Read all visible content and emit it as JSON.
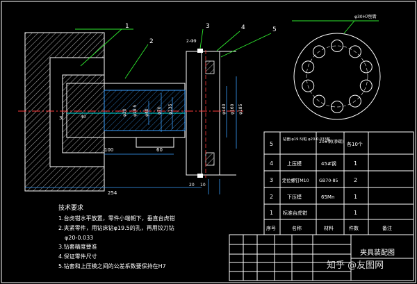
{
  "colors": {
    "background": "#000000",
    "outline": "#ffffff",
    "leader": "#2ee82e",
    "dimension": "#3aa0ff",
    "centerline": "#ff3b3b",
    "cyan": "#00e5e5",
    "yellow": "#ffe600",
    "magenta": "#ff33ff"
  },
  "balloons": [
    "1",
    "2",
    "3",
    "4",
    "5"
  ],
  "dims": {
    "overall_length": "254",
    "d100": "100",
    "d60": "60",
    "d3": "3",
    "d40": "40",
    "d10": "10",
    "d20": "20",
    "d60v": "60",
    "d185": "φ185",
    "d160": "φ160",
    "d140": "φ140",
    "d135": "φ135",
    "d70": "φ70",
    "d40s": "φ40",
    "d195": "φ19.5",
    "d20h": "φ20",
    "d30": "φ30H7"
  },
  "annotations": {
    "top_callout": "2-Φ9",
    "hole_callout": "φ30H7刨青"
  },
  "requirements": {
    "title": "技术要求",
    "items": [
      "1.台虎钳水平放置，零件小端朝下，垂直台虎钳",
      "2.夹紧零件，用钻床钻φ19.5的孔，再用铰刀钻",
      "φ20-0.033",
      "3.钻套精度要准",
      "4.保证零件尺寸",
      "5.钻套和上压模之间的公差系数要保持在H7"
    ]
  },
  "bom": {
    "rows": [
      {
        "no": "5",
        "name": "钻套(φ19.5)粧 φ20-0.033粧",
        "material": "20#钢(渗碳)",
        "qty": "各10个",
        "remark": ""
      },
      {
        "no": "4",
        "name": "上压模",
        "material": "45#钢",
        "qty": "1",
        "remark": ""
      },
      {
        "no": "3",
        "name": "定位螺钉M10",
        "material": "GB70-85",
        "qty": "2",
        "remark": ""
      },
      {
        "no": "2",
        "name": "下压模",
        "material": "65Mn",
        "qty": "1",
        "remark": ""
      },
      {
        "no": "1",
        "name": "标准台虎钳",
        "material": "",
        "qty": "1",
        "remark": ""
      }
    ],
    "headers": {
      "no": "序号",
      "name": "名称",
      "material": "材料",
      "qty": "件数",
      "remark": "备注"
    }
  },
  "title_block": {
    "drawing_title": "夹具装配图",
    "watermark": "知乎 @友图网"
  }
}
